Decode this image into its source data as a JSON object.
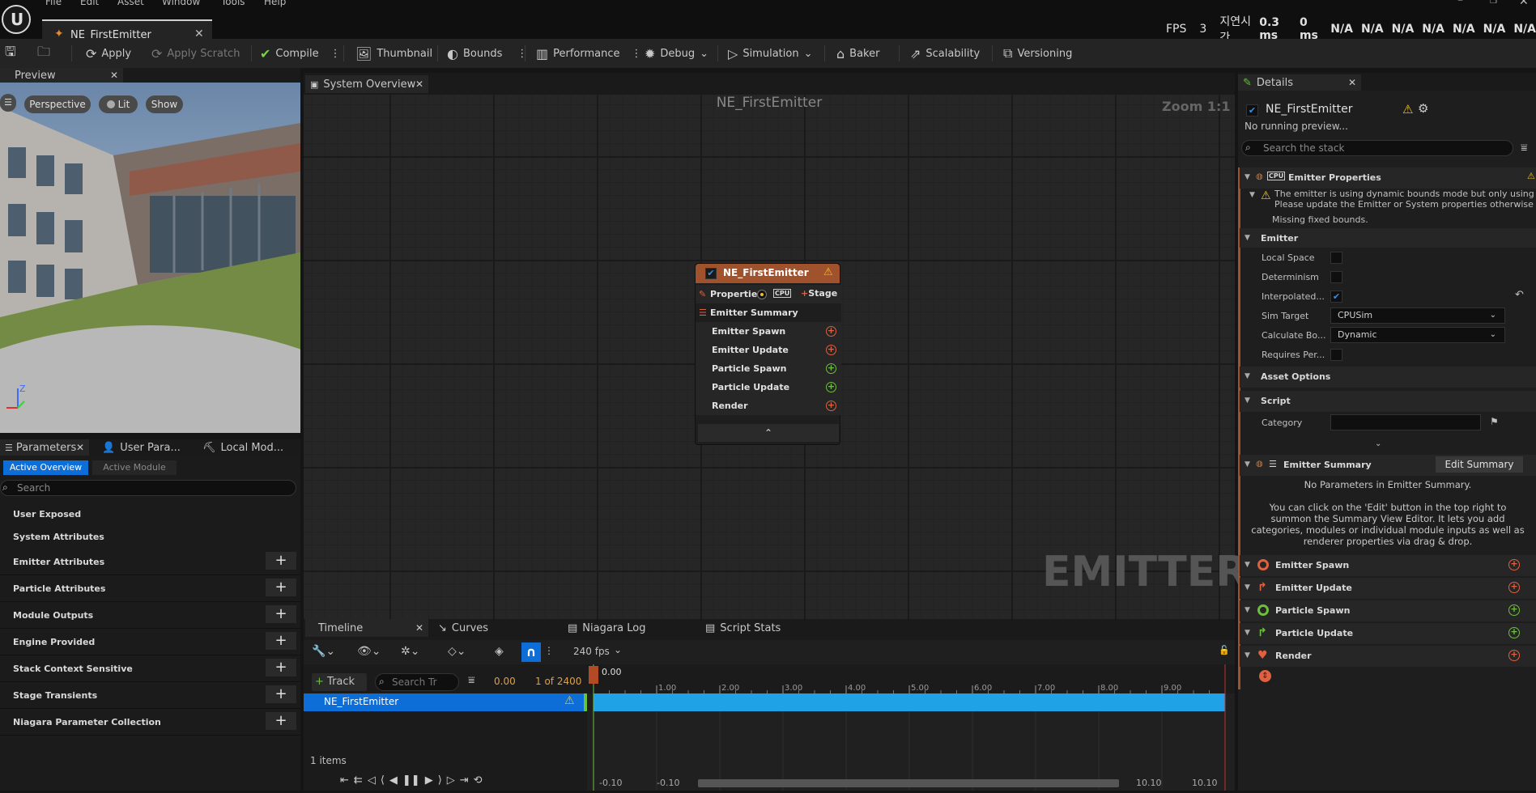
{
  "menu": [
    "File",
    "Edit",
    "Asset",
    "Window",
    "Tools",
    "Help"
  ],
  "document_tab": {
    "title": "NE_FirstEmitter"
  },
  "stats": {
    "fps_label": "FPS",
    "fps_value": "3",
    "latency_label": "지연시간",
    "v1": "0.3 ms",
    "v2": "0 ms",
    "na": [
      "N/A",
      "N/A",
      "N/A",
      "N/A",
      "N/A",
      "N/A",
      "N/A"
    ]
  },
  "toolbar": {
    "apply": "Apply",
    "apply_scratch": "Apply Scratch",
    "compile": "Compile",
    "thumbnail": "Thumbnail",
    "bounds": "Bounds",
    "performance": "Performance",
    "debug": "Debug",
    "simulation": "Simulation",
    "baker": "Baker",
    "scalability": "Scalability",
    "versioning": "Versioning"
  },
  "preview": {
    "tab": "Preview",
    "perspective": "Perspective",
    "lit": "Lit",
    "show": "Show",
    "axis_z": "Z"
  },
  "params": {
    "tabs": [
      "Parameters",
      "User Para...",
      "Local Mod..."
    ],
    "subtabs": [
      "Active Overview",
      "Active Module"
    ],
    "search_placeholder": "Search",
    "rows": [
      "User Exposed",
      "System Attributes",
      "Emitter Attributes",
      "Particle Attributes",
      "Module Outputs",
      "Engine Provided",
      "Stack Context Sensitive",
      "Stage Transients",
      "Niagara Parameter Collection"
    ]
  },
  "graph": {
    "tab": "System Overview",
    "title": "NE_FirstEmitter",
    "zoom": "Zoom 1:1",
    "watermark": "EMITTER"
  },
  "node": {
    "title": "NE_FirstEmitter",
    "properties": "Properties",
    "cpu": "CPU",
    "stage": "Stage",
    "summary": "Emitter Summary",
    "stages": [
      "Emitter Spawn",
      "Emitter Update",
      "Particle Spawn",
      "Particle Update",
      "Render"
    ],
    "colors": [
      "#e06040",
      "#e06040",
      "#6cc03c",
      "#6cc03c",
      "#e06040"
    ]
  },
  "timeline": {
    "tabs": [
      "Timeline",
      "Curves",
      "Niagara Log",
      "Script Stats"
    ],
    "fps": "240 fps",
    "track_btn": "Track",
    "search_placeholder": "Search Tr",
    "time": "0.00",
    "frames": "1 of 2400",
    "track": "NE_FirstEmitter",
    "marker": "0.00",
    "ticks": [
      "1.00",
      "2.00",
      "3.00",
      "4.00",
      "5.00",
      "6.00",
      "7.00",
      "8.00",
      "9.00"
    ],
    "items": "1 items",
    "range": [
      "-0.10",
      "-0.10",
      "10.10",
      "10.10"
    ]
  },
  "details": {
    "tab": "Details",
    "emitter": "NE_FirstEmitter",
    "no_preview": "No running preview...",
    "search_placeholder": "Search the stack",
    "emitter_properties": "Emitter Properties",
    "warning1": "The emitter is using dynamic bounds mode but only using Em",
    "warning2": "Please update the Emitter or System properties otherwise bo",
    "missing": "Missing fixed bounds.",
    "emitter_section": "Emitter",
    "props": [
      "Local Space",
      "Determinism",
      "Interpolated...",
      "Sim Target",
      "Calculate Bo...",
      "Requires Per..."
    ],
    "sim_target": "CPUSim",
    "calc_bounds": "Dynamic",
    "asset_options": "Asset Options",
    "script": "Script",
    "category": "Category",
    "emitter_summary": "Emitter Summary",
    "edit_summary": "Edit Summary",
    "no_params": "No Parameters in Emitter Summary.",
    "help": [
      "You can click on the 'Edit' button in the top right to",
      "summon the Summary View Editor. It lets you add",
      "categories, modules or individual module inputs as well as",
      "renderer properties via drag & drop."
    ],
    "stages": [
      "Emitter Spawn",
      "Emitter Update",
      "Particle Spawn",
      "Particle Update",
      "Render"
    ]
  }
}
